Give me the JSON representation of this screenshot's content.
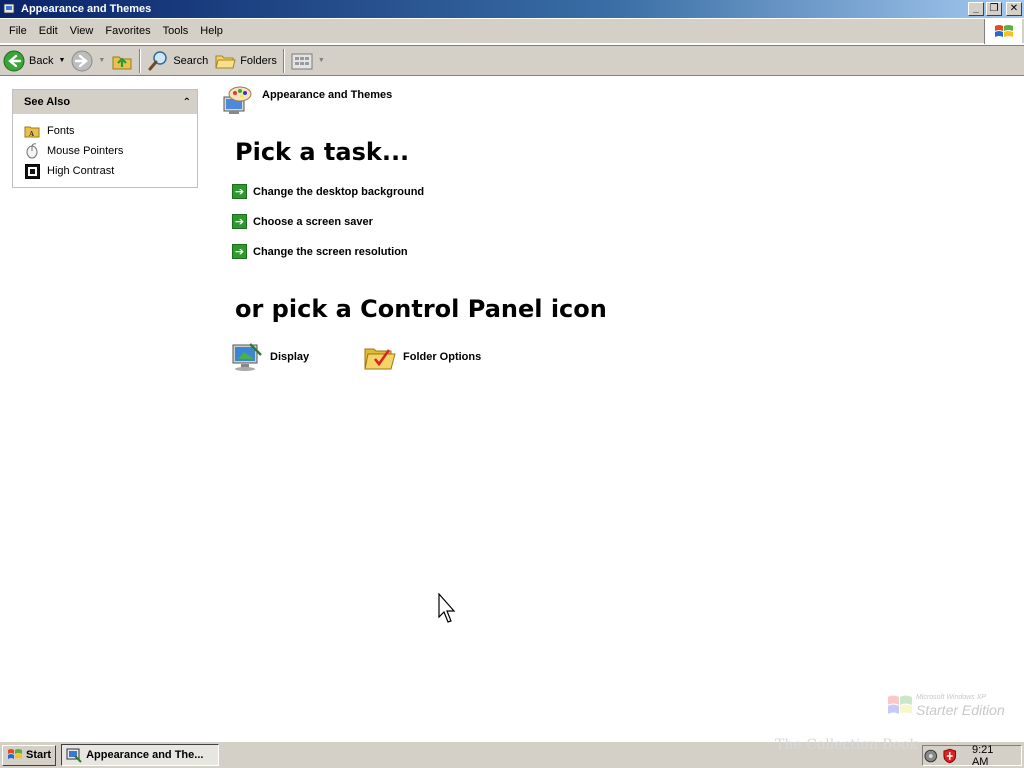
{
  "window": {
    "title": "Appearance and Themes"
  },
  "menu": [
    "File",
    "Edit",
    "View",
    "Favorites",
    "Tools",
    "Help"
  ],
  "toolbar": {
    "back": "Back",
    "search": "Search",
    "folders": "Folders"
  },
  "see_also": {
    "title": "See Also",
    "items": [
      {
        "label": "Fonts",
        "icon": "fonts-folder-icon"
      },
      {
        "label": "Mouse Pointers",
        "icon": "mouse-icon"
      },
      {
        "label": "High Contrast",
        "icon": "high-contrast-icon"
      }
    ]
  },
  "main": {
    "header": "Appearance and Themes",
    "pick_task": "Pick a task...",
    "tasks": [
      "Change the desktop background",
      "Choose a screen saver",
      "Change the screen resolution"
    ],
    "or_pick": "or pick a Control Panel icon",
    "icons": [
      {
        "label": "Display"
      },
      {
        "label": "Folder Options"
      }
    ]
  },
  "watermark": {
    "small": "Microsoft Windows XP",
    "big": "Starter Edition",
    "collection": "The Collection Book"
  },
  "taskbar": {
    "start": "Start",
    "task_button": "Appearance and The...",
    "time": "9:21 AM"
  },
  "colors": {
    "title_start": "#0a246a",
    "title_end": "#a6caf0",
    "chrome": "#d4d0c8",
    "task_arrow": "#2e9a2e"
  }
}
